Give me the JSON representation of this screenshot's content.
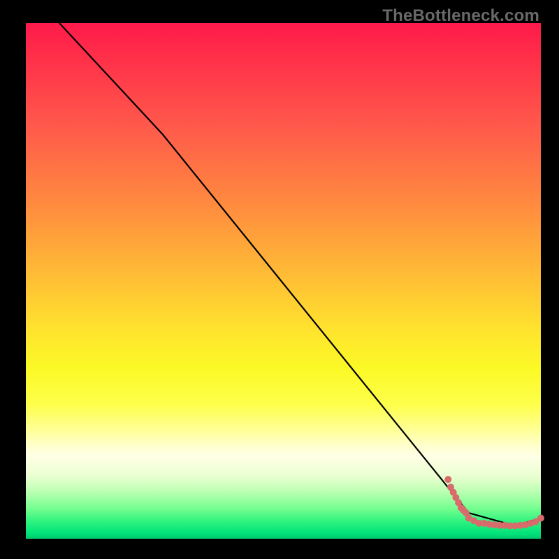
{
  "watermark": "TheBottleneck.com",
  "chart_data": {
    "type": "line",
    "title": "",
    "xlabel": "",
    "ylabel": "",
    "xlim": [
      0,
      100
    ],
    "ylim": [
      0,
      100
    ],
    "series": [
      {
        "name": "curve",
        "x": [
          6.5,
          26.5,
          86.0,
          95.0,
          100.0
        ],
        "y": [
          100.0,
          78.5,
          5.0,
          2.5,
          4.0
        ]
      }
    ],
    "markers": {
      "name": "data-points",
      "color": "#d86b6b",
      "points": [
        {
          "x": 82.0,
          "y": 11.5
        },
        {
          "x": 82.5,
          "y": 10.0
        },
        {
          "x": 83.0,
          "y": 9.0
        },
        {
          "x": 83.5,
          "y": 8.0
        },
        {
          "x": 84.0,
          "y": 7.0
        },
        {
          "x": 84.5,
          "y": 6.0
        },
        {
          "x": 85.0,
          "y": 5.5
        },
        {
          "x": 85.5,
          "y": 5.0
        },
        {
          "x": 86.0,
          "y": 4.0
        },
        {
          "x": 87.0,
          "y": 3.5
        },
        {
          "x": 88.0,
          "y": 3.0
        },
        {
          "x": 89.0,
          "y": 3.0
        },
        {
          "x": 90.0,
          "y": 2.8
        },
        {
          "x": 91.0,
          "y": 2.7
        },
        {
          "x": 92.0,
          "y": 2.6
        },
        {
          "x": 93.0,
          "y": 2.6
        },
        {
          "x": 94.0,
          "y": 2.5
        },
        {
          "x": 95.0,
          "y": 2.5
        },
        {
          "x": 96.0,
          "y": 2.6
        },
        {
          "x": 97.0,
          "y": 2.7
        },
        {
          "x": 98.0,
          "y": 3.0
        },
        {
          "x": 99.0,
          "y": 3.3
        },
        {
          "x": 100.0,
          "y": 4.0
        }
      ]
    }
  }
}
